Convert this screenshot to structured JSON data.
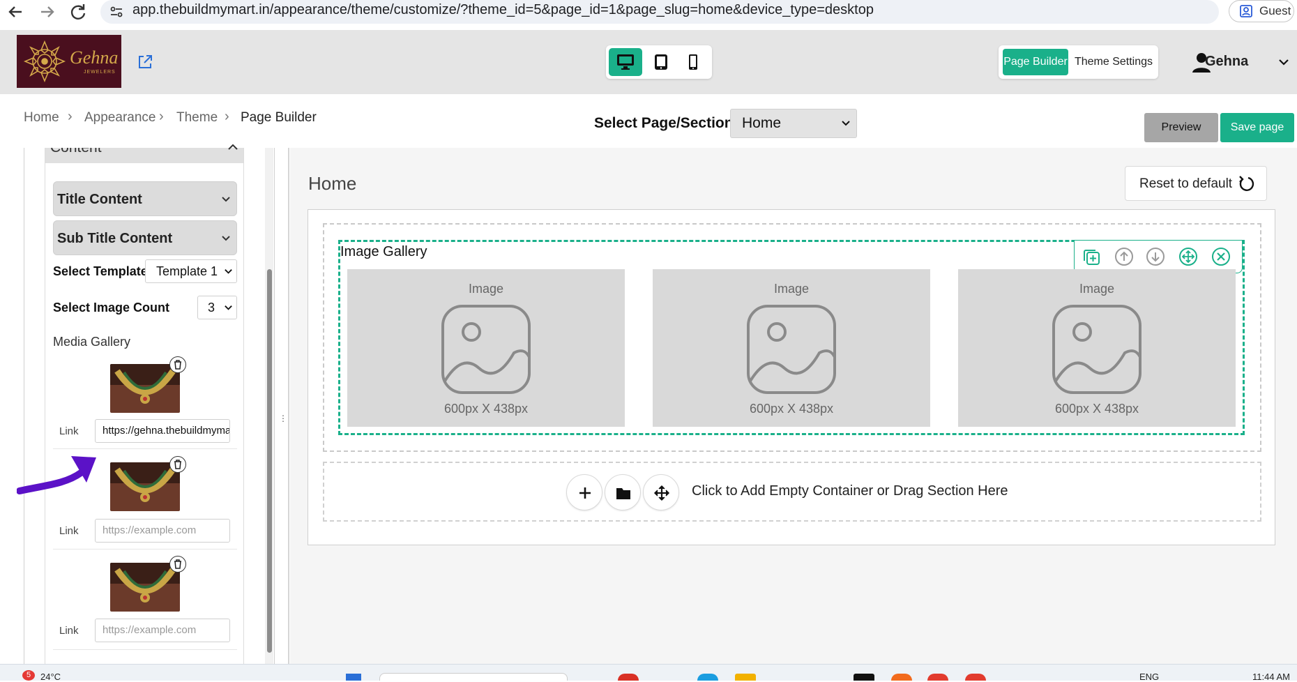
{
  "browser": {
    "url": "app.thebuildmymart.in/appearance/theme/customize/?theme_id=5&page_id=1&page_slug=home&device_type=desktop",
    "profile_label": "Guest",
    "icons": [
      "back-arrow-icon",
      "forward-arrow-icon",
      "reload-icon",
      "site-settings-icon",
      "profile-icon"
    ]
  },
  "header": {
    "logo_text": "Gehna",
    "logo_subtext": "JEWELERS",
    "device_buttons": [
      "desktop-icon",
      "tablet-icon",
      "mobile-icon"
    ],
    "builder_tabs": {
      "page_builder": "Page Builder",
      "theme_settings": "Theme Settings"
    },
    "user_name": "Gehna"
  },
  "breadcrumb": {
    "items": [
      "Home",
      "Appearance",
      "Theme",
      "Page Builder"
    ]
  },
  "page_select": {
    "label": "Select Page/Section:",
    "value": "Home"
  },
  "actions": {
    "preview": "Preview",
    "save": "Save page"
  },
  "left_panel": {
    "section_label": "Content",
    "accordions": [
      "Title Content",
      "Sub Title Content"
    ],
    "select_template": {
      "label": "Select Template",
      "value": "Template 1"
    },
    "select_image_count": {
      "label": "Select Image Count",
      "value": "3"
    },
    "media_gallery_label": "Media Gallery",
    "media_items": [
      {
        "link_label": "Link",
        "link_value": "https://gehna.thebuildmymart.in",
        "placeholder": "https://example.com"
      },
      {
        "link_label": "Link",
        "link_value": "",
        "placeholder": "https://example.com"
      },
      {
        "link_label": "Link",
        "link_value": "",
        "placeholder": "https://example.com"
      }
    ]
  },
  "canvas": {
    "page_title": "Home",
    "reset_label": "Reset to default",
    "gallery_title": "Image Gallery",
    "toolbar_icons": [
      "duplicate-icon",
      "move-up-icon",
      "move-down-icon",
      "drag-move-icon",
      "remove-icon"
    ],
    "placeholders": [
      {
        "label": "Image",
        "size": "600px X 438px"
      },
      {
        "label": "Image",
        "size": "600px X 438px"
      },
      {
        "label": "Image",
        "size": "600px X 438px"
      }
    ],
    "add_container_text": "Click to Add Empty Container or Drag Section Here"
  },
  "taskbar": {
    "weather": "24°C",
    "notification_count": "5",
    "language": "ENG",
    "time": "11:44 AM"
  },
  "colors": {
    "accent": "#1ab08a",
    "annotation_arrow": "#5b12c7",
    "logo_bg": "#4a0f1e"
  }
}
